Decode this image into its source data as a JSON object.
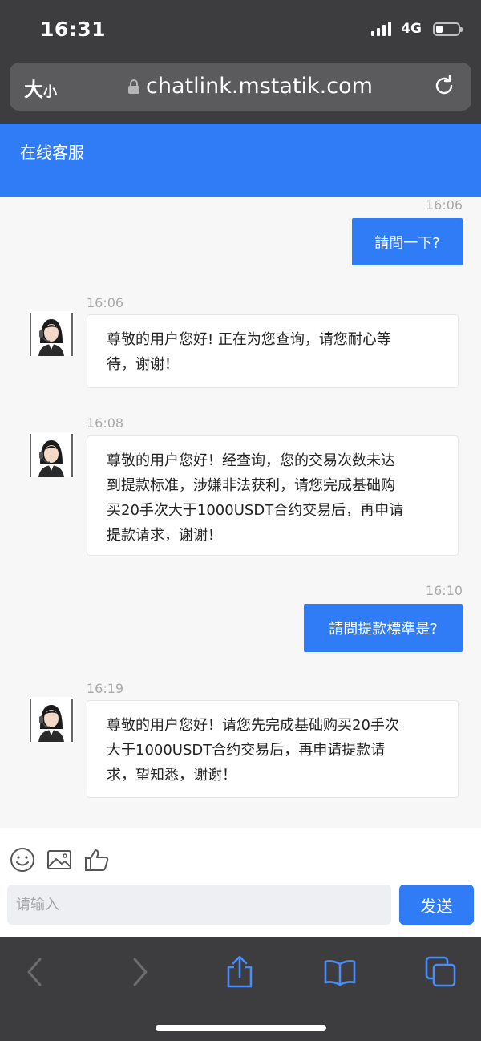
{
  "status_bar": {
    "time": "16:31",
    "network": "4G"
  },
  "browser": {
    "text_size_big": "大",
    "text_size_small": "小",
    "url": "chatlink.mstatik.com"
  },
  "app": {
    "title": "在线客服"
  },
  "messages": [
    {
      "direction": "out",
      "time": "16:06",
      "text": "請問一下?"
    },
    {
      "direction": "in",
      "time": "16:06",
      "lines": [
        "尊敬的用户您好! 正在为您查询，请您耐心等",
        "待，谢谢！"
      ]
    },
    {
      "direction": "in",
      "time": "16:08",
      "lines": [
        "尊敬的用户您好！经查询，您的交易次数未达",
        "到提款标准，涉嫌非法获利，请您完成基础购",
        "买20手次大于1000USDT合约交易后，再申请",
        "提款请求，谢谢！"
      ]
    },
    {
      "direction": "out",
      "time": "16:10",
      "text": "請問提款標準是?"
    },
    {
      "direction": "in",
      "time": "16:19",
      "lines": [
        "尊敬的用户您好！请您先完成基础购买20手次",
        "大于1000USDT合约交易后，再申请提款请",
        "求，望知悉，谢谢！"
      ]
    }
  ],
  "composer": {
    "placeholder": "请输入",
    "send_label": "发送",
    "icons": [
      "emoji-icon",
      "image-icon",
      "thumbs-up-icon"
    ]
  },
  "toolbar": {
    "icons": [
      "back-icon",
      "forward-icon",
      "share-icon",
      "bookmarks-icon",
      "tabs-icon"
    ]
  },
  "colors": {
    "accent": "#2f7cf6",
    "chrome": "#3d3d3f",
    "chat_bg": "#f7f7f7"
  }
}
